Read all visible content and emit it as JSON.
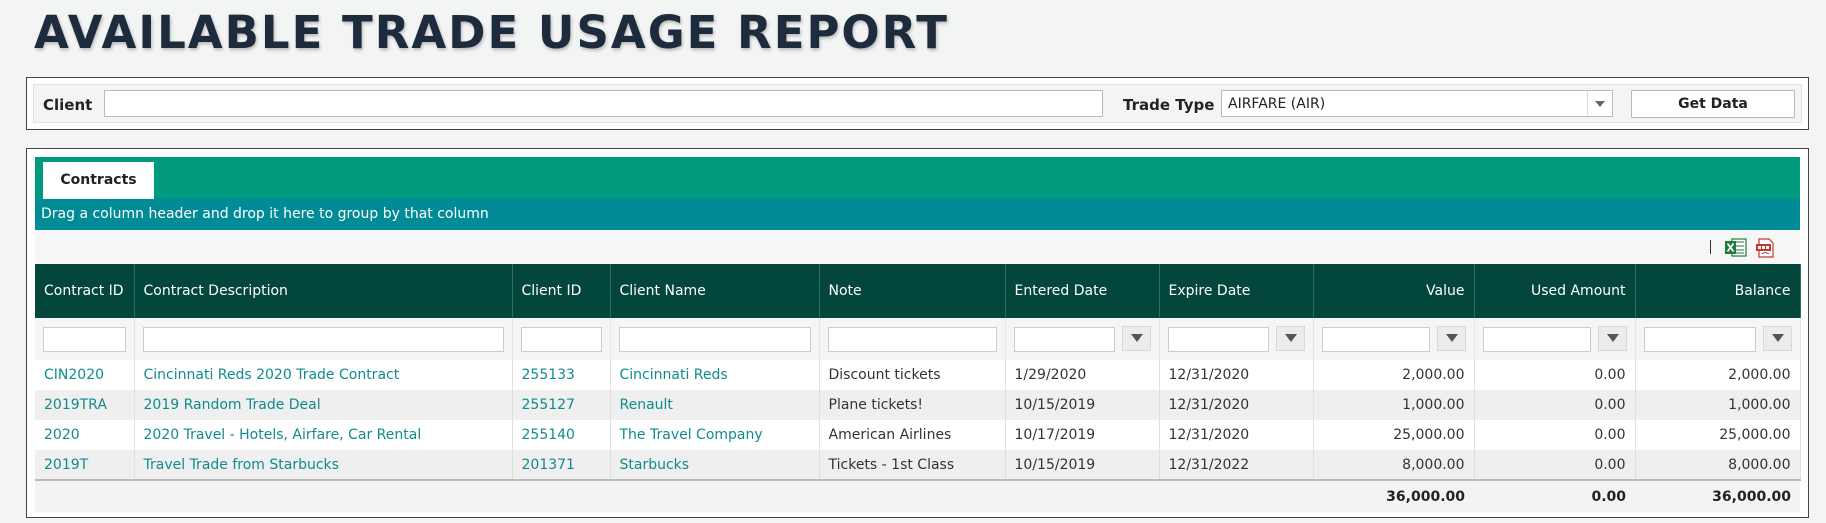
{
  "page": {
    "title": "AVAILABLE TRADE USAGE REPORT"
  },
  "filters": {
    "client_label": "Client",
    "client_value": "",
    "trade_type_label": "Trade Type",
    "trade_type_value": "AIRFARE (AIR)",
    "get_data_label": "Get Data"
  },
  "tabs": [
    {
      "label": "Contracts",
      "active": true
    }
  ],
  "grid": {
    "group_hint": "Drag a column header and drop it here to group by that column",
    "toolbar_icons": [
      "excel-export-icon",
      "pdf-export-icon"
    ],
    "columns": [
      "Contract ID",
      "Contract Description",
      "Client ID",
      "Client Name",
      "Note",
      "Entered Date",
      "Expire Date",
      "Value",
      "Used Amount",
      "Balance"
    ],
    "rows": [
      [
        "CIN2020",
        "Cincinnati Reds 2020 Trade Contract",
        "255133",
        "Cincinnati Reds",
        "Discount tickets",
        "1/29/2020",
        "12/31/2020",
        "2,000.00",
        "0.00",
        "2,000.00"
      ],
      [
        "2019TRA",
        "2019 Random Trade Deal",
        "255127",
        "Renault",
        "Plane tickets!",
        "10/15/2019",
        "12/31/2020",
        "1,000.00",
        "0.00",
        "1,000.00"
      ],
      [
        "2020",
        "2020 Travel - Hotels, Airfare, Car Rental",
        "255140",
        "The Travel Company",
        "American Airlines",
        "10/17/2019",
        "12/31/2020",
        "25,000.00",
        "0.00",
        "25,000.00"
      ],
      [
        "2019T",
        "Travel Trade from Starbucks",
        "201371",
        "Starbucks",
        "Tickets - 1st Class",
        "10/15/2019",
        "12/31/2022",
        "8,000.00",
        "0.00",
        "8,000.00"
      ]
    ],
    "totals": {
      "value": "36,000.00",
      "used_amount": "0.00",
      "balance": "36,000.00"
    }
  },
  "colors": {
    "title": "#1e2b3c",
    "tabstrip": "#009a7e",
    "group_bar": "#018b97",
    "header": "#03463b",
    "link": "#0f8b8d"
  }
}
